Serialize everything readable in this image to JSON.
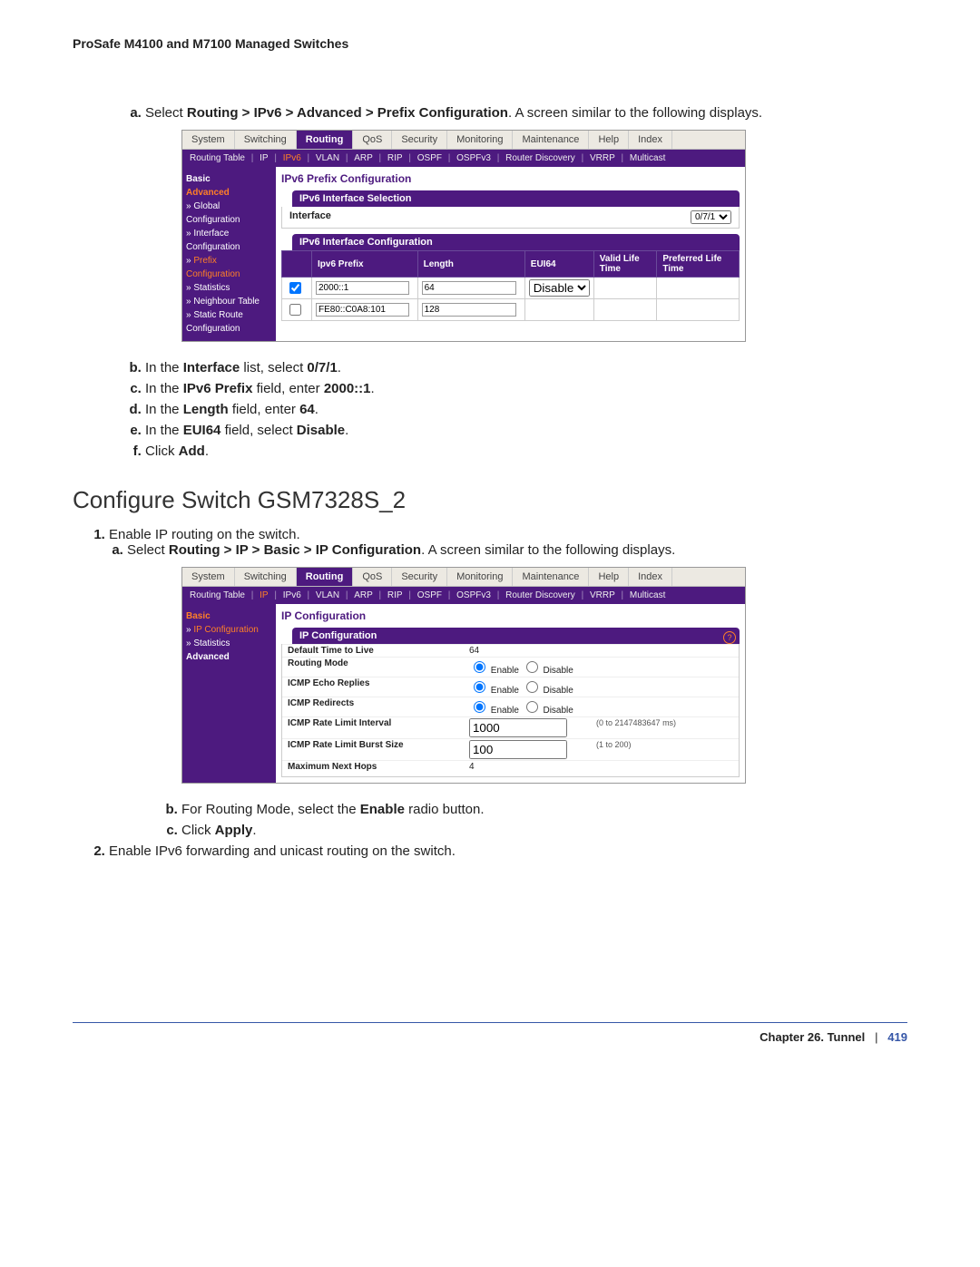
{
  "header": "ProSafe M4100 and M7100 Managed Switches",
  "stepsA": {
    "a": {
      "pre": "Select ",
      "bold": "Routing > IPv6 > Advanced > Prefix Configuration",
      "post": ". A screen similar to the following displays."
    },
    "b": {
      "pre": "In the ",
      "bold1": "Interface",
      "mid": " list, select ",
      "bold2": "0/7/1",
      "post": "."
    },
    "c": {
      "pre": "In the ",
      "bold1": "IPv6 Prefix",
      "mid": " field, enter ",
      "bold2": "2000::1",
      "post": "."
    },
    "d": {
      "pre": "In the ",
      "bold1": "Length",
      "mid": " field, enter ",
      "bold2": "64",
      "post": "."
    },
    "e": {
      "pre": "In the ",
      "bold1": "EUI64",
      "mid": " field, select ",
      "bold2": "Disable",
      "post": "."
    },
    "f": {
      "pre": "Click ",
      "bold": "Add",
      "post": "."
    }
  },
  "section2_title": "Configure Switch GSM7328S_2",
  "num1": "Enable IP routing on the switch.",
  "num1a": {
    "pre": "Select ",
    "bold": "Routing > IP > Basic > IP Configuration",
    "post": ". A screen similar to the following displays."
  },
  "num1b": {
    "pre": "For Routing Mode, select the ",
    "bold": "Enable",
    "post": " radio button."
  },
  "num1c": {
    "pre": "Click ",
    "bold": "Apply",
    "post": "."
  },
  "num2": "Enable IPv6 forwarding and unicast routing on the switch.",
  "shot1": {
    "tabs": [
      "System",
      "Switching",
      "Routing",
      "QoS",
      "Security",
      "Monitoring",
      "Maintenance",
      "Help",
      "Index"
    ],
    "subtabs": [
      "Routing Table",
      "IP",
      "IPv6",
      "VLAN",
      "ARP",
      "RIP",
      "OSPF",
      "OSPFv3",
      "Router Discovery",
      "VRRP",
      "Multicast"
    ],
    "activesub": "IPv6",
    "sidenav": {
      "basic": "Basic",
      "advanced": "Advanced",
      "items": [
        "Global Configuration",
        "Interface Configuration",
        "Prefix Configuration",
        "Statistics",
        "Neighbour Table",
        "Static Route Configuration"
      ],
      "active": "Prefix Configuration"
    },
    "title": "IPv6 Prefix Configuration",
    "sel_title": "IPv6 Interface Selection",
    "iflabel": "Interface",
    "ifvalue": "0/7/1",
    "conf_title": "IPv6 Interface Configuration",
    "cols": [
      "Ipv6 Prefix",
      "Length",
      "EUI64",
      "Valid Life Time",
      "Preferred Life Time"
    ],
    "rows": [
      {
        "checked": true,
        "prefix": "2000::1",
        "len": "64",
        "eui": "Disable"
      },
      {
        "checked": false,
        "prefix": "FE80::C0A8:101",
        "len": "128",
        "eui": ""
      }
    ]
  },
  "shot2": {
    "tabs": [
      "System",
      "Switching",
      "Routing",
      "QoS",
      "Security",
      "Monitoring",
      "Maintenance",
      "Help",
      "Index"
    ],
    "subtabs": [
      "Routing Table",
      "IP",
      "IPv6",
      "VLAN",
      "ARP",
      "RIP",
      "OSPF",
      "OSPFv3",
      "Router Discovery",
      "VRRP",
      "Multicast"
    ],
    "activesub": "IP",
    "sidenav": {
      "basic": "Basic",
      "items": [
        "IP Configuration",
        "Statistics"
      ],
      "active": "IP Configuration",
      "advanced": "Advanced"
    },
    "title": "IP Configuration",
    "bar": "IP Configuration",
    "rows": [
      {
        "lbl": "Default Time to Live",
        "val": "64",
        "type": "text"
      },
      {
        "lbl": "Routing Mode",
        "type": "radio",
        "sel": "Enable"
      },
      {
        "lbl": "ICMP Echo Replies",
        "type": "radio",
        "sel": "Enable"
      },
      {
        "lbl": "ICMP Redirects",
        "type": "radio",
        "sel": "Enable"
      },
      {
        "lbl": "ICMP Rate Limit Interval",
        "val": "1000",
        "type": "input",
        "hint": "(0 to 2147483647 ms)"
      },
      {
        "lbl": "ICMP Rate Limit Burst Size",
        "val": "100",
        "type": "input",
        "hint": "(1 to 200)"
      },
      {
        "lbl": "Maximum Next Hops",
        "val": "4",
        "type": "text"
      }
    ],
    "radio_opts": [
      "Enable",
      "Disable"
    ]
  },
  "footer": {
    "chapter": "Chapter 26.  Tunnel",
    "page": "419"
  }
}
